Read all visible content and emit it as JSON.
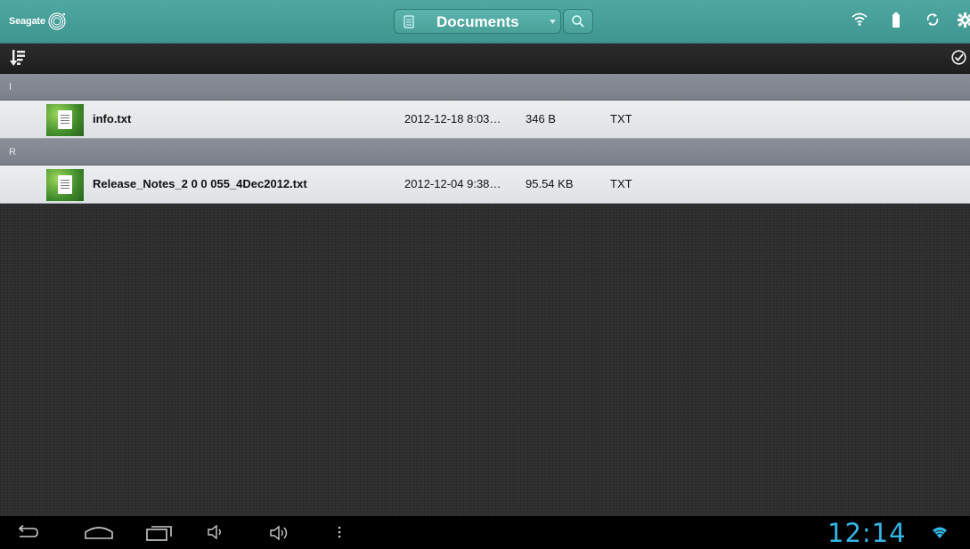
{
  "header": {
    "brand": "Seagate",
    "folder_title": "Documents",
    "icons": [
      "wifi-icon",
      "battery-icon",
      "sync-icon",
      "settings-icon"
    ]
  },
  "toolbar": {
    "sort_icon": "sort-icon",
    "select_icon": "check-circle-icon"
  },
  "sections": [
    {
      "letter": "I",
      "files": [
        {
          "name": "info.txt",
          "date": "2012-12-18 8:03…",
          "size": "346 B",
          "type": "TXT"
        }
      ]
    },
    {
      "letter": "R",
      "files": [
        {
          "name": "Release_Notes_2 0 0 055_4Dec2012.txt",
          "date": "2012-12-04 9:38…",
          "size": "95.54 KB",
          "type": "TXT"
        }
      ]
    }
  ],
  "navbar": {
    "clock": "12:14",
    "buttons": [
      "back-icon",
      "home-icon",
      "recent-apps-icon",
      "volume-down-icon",
      "volume-up-icon",
      "menu-icon"
    ]
  },
  "colors": {
    "accent": "#4aa19a",
    "clock": "#33b5e5",
    "section_header": "#828791",
    "row": "#e5e7e9"
  }
}
